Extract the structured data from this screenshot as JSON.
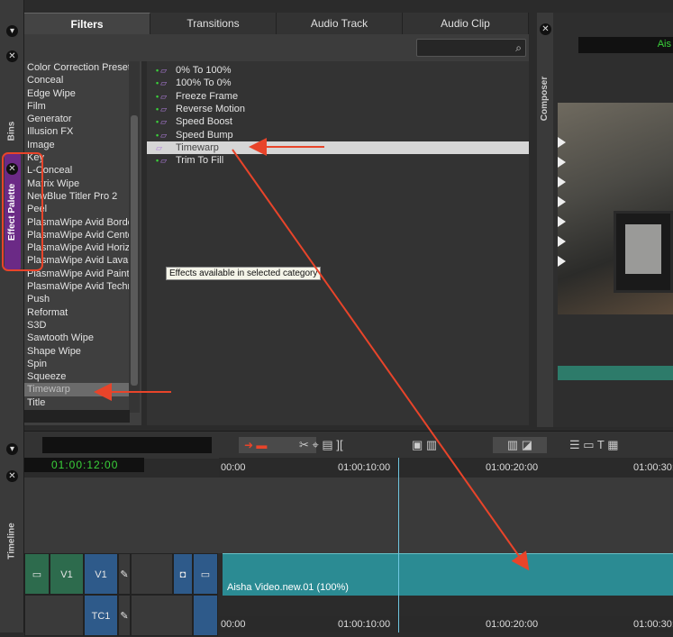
{
  "tabs": [
    {
      "label": "Filters",
      "active": true
    },
    {
      "label": "Transitions",
      "active": false
    },
    {
      "label": "Audio Track",
      "active": false
    },
    {
      "label": "Audio Clip",
      "active": false
    }
  ],
  "side_tabs": {
    "bins": "Bins",
    "effect_palette": "Effect Palette",
    "timeline": "Timeline",
    "composer": "Composer"
  },
  "categories": [
    "Color Correction Preset ▲",
    "Conceal",
    "Edge Wipe",
    "Film",
    "Generator",
    "Illusion FX",
    "Image",
    "Key",
    "L-Conceal",
    "Matrix Wipe",
    "NewBlue Titler Pro 2",
    "Peel",
    "PlasmaWipe Avid Borde",
    "PlasmaWipe Avid Cente",
    "PlasmaWipe Avid Horiz",
    "PlasmaWipe Avid Lava",
    "PlasmaWipe Avid Paint",
    "PlasmaWipe Avid Techr",
    "Push",
    "Reformat",
    "S3D",
    "Sawtooth Wipe",
    "Shape Wipe",
    "Spin",
    "Squeeze",
    "Timewarp",
    "Title"
  ],
  "selected_category": "Timewarp",
  "effects": [
    "0% To 100%",
    "100% To 0%",
    "Freeze Frame",
    "Reverse Motion",
    "Speed Boost",
    "Speed Bump",
    "Timewarp",
    "Trim To Fill"
  ],
  "selected_effect": "Timewarp",
  "tooltip": "Effects available in selected category",
  "viewer_title": "Ais",
  "timeline": {
    "timecode": "01:00:12:00",
    "ruler": [
      "00:00",
      "01:00:10:00",
      "01:00:20:00",
      "01:00:30:"
    ],
    "tracks": {
      "v1_left": "V1",
      "v1_right": "V1",
      "tc1": "TC1"
    },
    "clip_label": "Aisha Video.new.01 (100%)"
  },
  "colors": {
    "accent_purple": "#6b2a86",
    "annotation_red": "#e8442a",
    "timecode_green": "#3ad13a",
    "clip_teal": "#2b8b93"
  }
}
